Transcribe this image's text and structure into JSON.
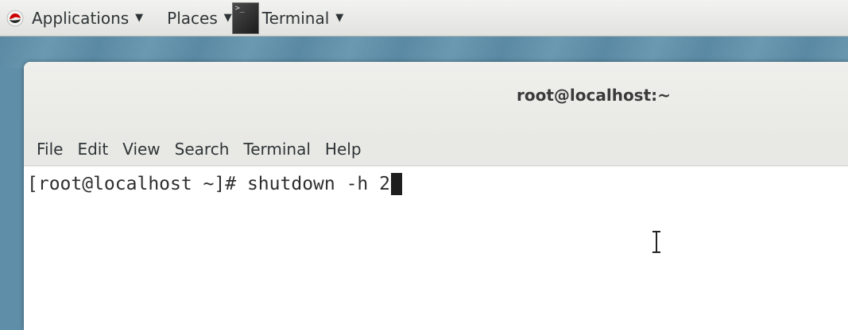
{
  "top_panel": {
    "applications_label": "Applications",
    "places_label": "Places",
    "terminal_label": "Terminal",
    "terminal_thumb_text": ">_"
  },
  "window": {
    "title": "root@localhost:~",
    "menu": [
      "File",
      "Edit",
      "View",
      "Search",
      "Terminal",
      "Help"
    ]
  },
  "terminal": {
    "prompt": "[root@localhost ~]# ",
    "command": "shutdown -h 2"
  },
  "colors": {
    "panel_bg": "#e9e9e6",
    "desktop_bg": "#5f8ea8",
    "terminal_bg": "#ffffff",
    "cursor": "#1e1e1e"
  }
}
